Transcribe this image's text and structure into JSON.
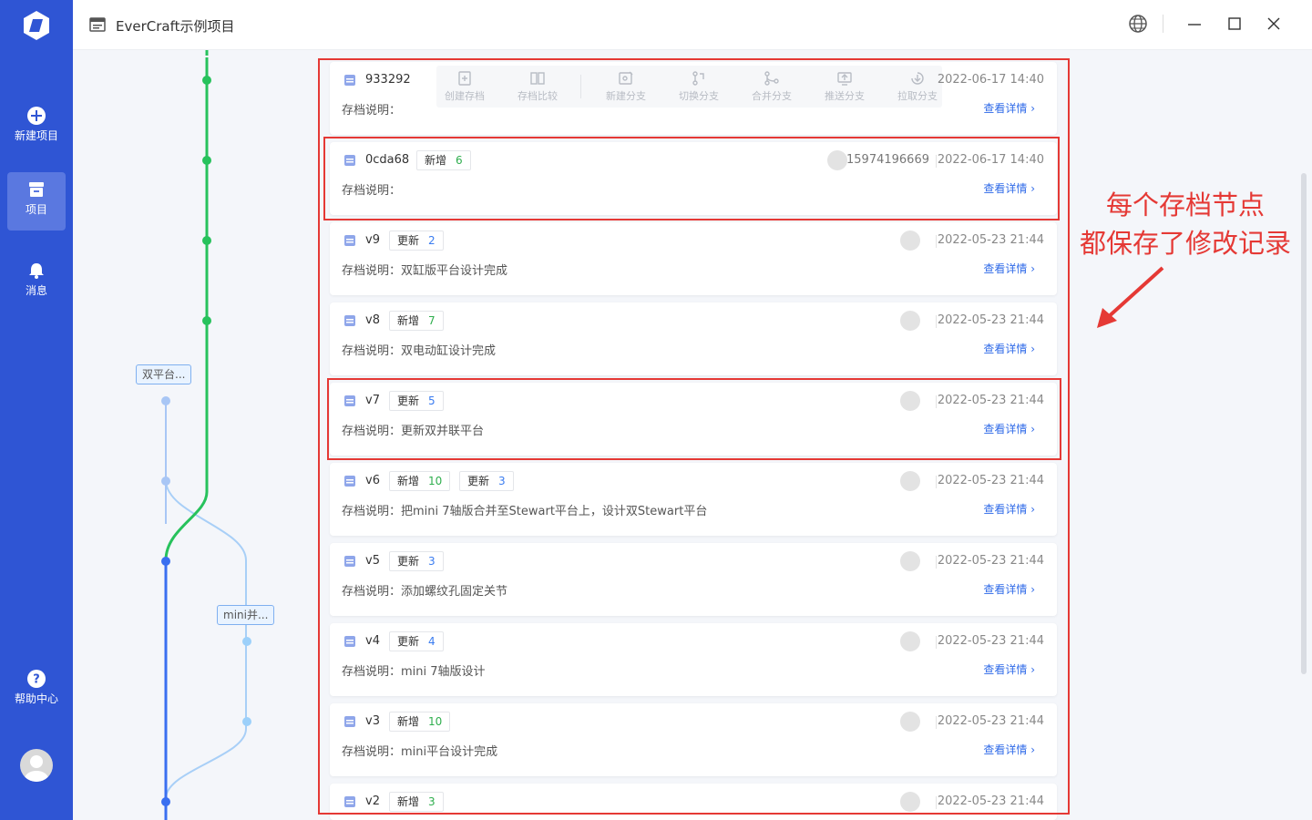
{
  "app": {
    "project_title": "EverCraft示例项目"
  },
  "sidebar": {
    "items": [
      {
        "label": "新建项目",
        "icon": "plus-circle-icon"
      },
      {
        "label": "项目",
        "icon": "archive-icon"
      },
      {
        "label": "消息",
        "icon": "bell-icon"
      },
      {
        "label": "帮助中心",
        "icon": "question-circle-icon"
      }
    ]
  },
  "graph": {
    "branch_tags": [
      "双平台...",
      "mini并..."
    ]
  },
  "toolbar": {
    "items": [
      "创建存档",
      "存档比较",
      "新建分支",
      "切换分支",
      "合并分支",
      "推送分支",
      "拉取分支"
    ]
  },
  "labels": {
    "desc_prefix": "存档说明：",
    "detail": "查看详情",
    "detail_arrow": "›"
  },
  "records": [
    {
      "version": "933292",
      "tags": [],
      "user": "",
      "time": "2022-06-17 14:40",
      "desc": ""
    },
    {
      "version": "0cda68",
      "tags": [
        {
          "label": "新增",
          "count": "6",
          "type": "add"
        }
      ],
      "user": "15974196669",
      "time": "2022-06-17 14:40",
      "desc": ""
    },
    {
      "version": "v9",
      "tags": [
        {
          "label": "更新",
          "count": "2",
          "type": "upd"
        }
      ],
      "user": "",
      "time": "2022-05-23 21:44",
      "desc": "双缸版平台设计完成"
    },
    {
      "version": "v8",
      "tags": [
        {
          "label": "新增",
          "count": "7",
          "type": "add"
        }
      ],
      "user": "",
      "time": "2022-05-23 21:44",
      "desc": "双电动缸设计完成"
    },
    {
      "version": "v7",
      "tags": [
        {
          "label": "更新",
          "count": "5",
          "type": "upd"
        }
      ],
      "user": "",
      "time": "2022-05-23 21:44",
      "desc": "更新双并联平台"
    },
    {
      "version": "v6",
      "tags": [
        {
          "label": "新增",
          "count": "10",
          "type": "add"
        },
        {
          "label": "更新",
          "count": "3",
          "type": "upd"
        }
      ],
      "user": "",
      "time": "2022-05-23 21:44",
      "desc": "把mini 7轴版合并至Stewart平台上，设计双Stewart平台"
    },
    {
      "version": "v5",
      "tags": [
        {
          "label": "更新",
          "count": "3",
          "type": "upd"
        }
      ],
      "user": "",
      "time": "2022-05-23 21:44",
      "desc": "添加螺纹孔固定关节"
    },
    {
      "version": "v4",
      "tags": [
        {
          "label": "更新",
          "count": "4",
          "type": "upd"
        }
      ],
      "user": "",
      "time": "2022-05-23 21:44",
      "desc": "mini 7轴版设计"
    },
    {
      "version": "v3",
      "tags": [
        {
          "label": "新增",
          "count": "10",
          "type": "add"
        }
      ],
      "user": "",
      "time": "2022-05-23 21:44",
      "desc": "mini平台设计完成"
    },
    {
      "version": "v2",
      "tags": [
        {
          "label": "新增",
          "count": "3",
          "type": "add"
        }
      ],
      "user": "",
      "time": "2022-05-23 21:44",
      "desc": ""
    }
  ],
  "annotation": {
    "line1": "每个存档节点",
    "line2": "都保存了修改记录"
  },
  "colors": {
    "sidebar": "#2f55d4",
    "main_branch": "#27c25c",
    "branch_blue": "#3a6ff0",
    "branch_light": "#9cc6f5",
    "annotation_red": "#e53935",
    "link": "#2f6ae8"
  }
}
